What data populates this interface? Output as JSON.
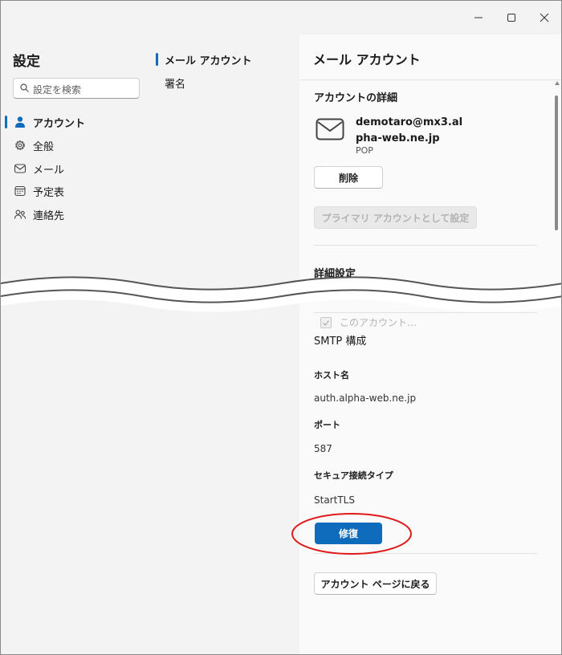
{
  "window": {
    "controls": {
      "minimize": "minimize-icon",
      "maximize": "maximize-icon",
      "close": "close-icon"
    }
  },
  "nav": {
    "title": "設定",
    "search_placeholder": "設定を検索",
    "items": [
      {
        "label": "アカウント",
        "icon": "person-icon",
        "active": true
      },
      {
        "label": "全般",
        "icon": "gear-icon"
      },
      {
        "label": "メール",
        "icon": "mail-icon"
      },
      {
        "label": "予定表",
        "icon": "calendar-icon"
      },
      {
        "label": "連絡先",
        "icon": "people-icon"
      }
    ]
  },
  "subnav": {
    "items": [
      {
        "label": "メール アカウント",
        "active": true
      },
      {
        "label": "署名"
      }
    ]
  },
  "detail": {
    "title": "メール アカウント",
    "account_section_title": "アカウントの詳細",
    "account_email": "demotaro@mx3.alpha-web.ne.jp",
    "account_type": "POP",
    "delete_button": "削除",
    "set_primary_button": "プライマリ アカウントとして設定",
    "advanced_title": "詳細設定",
    "advanced_checkbox_label": "このアカウント…　　　　　　　　　　　　　　　する",
    "smtp_title": "SMTP 構成",
    "host_label": "ホスト名",
    "host_value": "auth.alpha-web.ne.jp",
    "port_label": "ポート",
    "port_value": "587",
    "secure_label": "セキュア接続タイプ",
    "secure_value": "StartTLS",
    "repair_button": "修復",
    "back_button": "アカウント ページに戻る"
  },
  "colors": {
    "accent": "#0f6cbd",
    "highlight_ring": "#e0191b",
    "pane_background": "#fafafa",
    "sidebar_background": "#f3f3f3"
  }
}
